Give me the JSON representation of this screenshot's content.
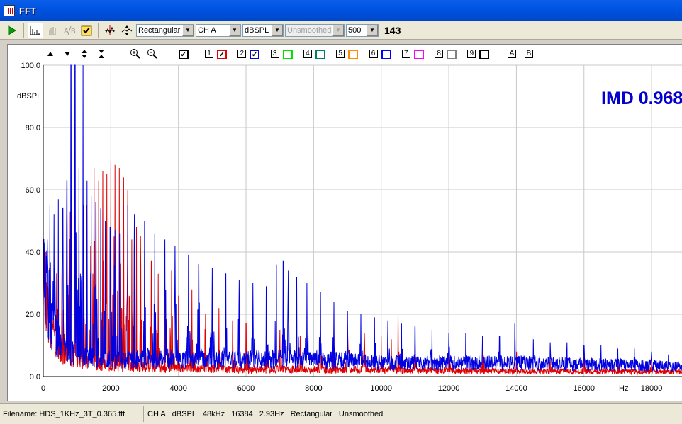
{
  "window": {
    "title": "FFT"
  },
  "toolbar": {
    "window_combo": "Rectangular",
    "channel_combo": "CH A",
    "units_combo": "dBSPL",
    "smoothing_combo": "Unsmoothed",
    "average_combo": "500",
    "count": "143"
  },
  "graph_toolbar": {
    "trace_labels": [
      "1",
      "2",
      "3",
      "4",
      "5",
      "6",
      "7",
      "8",
      "9"
    ],
    "trace_colors": [
      "#e00000",
      "#0000e0",
      "#00e000",
      "#008060",
      "#ff8c00",
      "#0000ff",
      "#ff00ff",
      "#808080",
      "#000000"
    ],
    "trace_checked": [
      true,
      true,
      false,
      false,
      false,
      false,
      false,
      false,
      false
    ],
    "marker_a": "A",
    "marker_b": "B"
  },
  "annotation": {
    "text": "IMD 0.968",
    "color": "#0000d0",
    "marker_color": "#e00000"
  },
  "chart_data": {
    "type": "line",
    "ylabel": "dBSPL",
    "xlabel": "Hz",
    "xlim": [
      0,
      18900
    ],
    "ylim": [
      0,
      100
    ],
    "x_ticks": [
      0,
      2000,
      4000,
      6000,
      8000,
      10000,
      12000,
      14000,
      16000,
      18000
    ],
    "x_tick_labels": [
      "0",
      "2000",
      "4000",
      "6000",
      "8000",
      "10000",
      "12000",
      "14000",
      "16000",
      "18000"
    ],
    "y_ticks": [
      0,
      20,
      40,
      60,
      80,
      100
    ],
    "y_tick_labels": [
      "0.0",
      "20.0",
      "40.0",
      "60.0",
      "80.0",
      "100.0"
    ],
    "grid": true,
    "series": [
      {
        "color": "#e00000",
        "floor": [
          [
            0,
            28
          ],
          [
            250,
            14
          ],
          [
            500,
            8
          ],
          [
            1000,
            5
          ],
          [
            2000,
            3
          ],
          [
            4000,
            2.5
          ],
          [
            6000,
            2
          ],
          [
            10000,
            2
          ],
          [
            14000,
            1.5
          ],
          [
            18900,
            1.5
          ]
        ],
        "peaks": [
          [
            80,
            40
          ],
          [
            180,
            35
          ],
          [
            400,
            33
          ],
          [
            560,
            38
          ],
          [
            700,
            50
          ],
          [
            800,
            53
          ],
          [
            940,
            52
          ],
          [
            1060,
            48
          ],
          [
            1180,
            46
          ],
          [
            1280,
            55
          ],
          [
            1400,
            42
          ],
          [
            1500,
            67
          ],
          [
            1640,
            63
          ],
          [
            1760,
            66
          ],
          [
            1880,
            65
          ],
          [
            2000,
            69
          ],
          [
            2120,
            68
          ],
          [
            2250,
            67
          ],
          [
            2380,
            64
          ],
          [
            2500,
            60
          ],
          [
            2620,
            44
          ],
          [
            2760,
            48
          ],
          [
            2880,
            45
          ],
          [
            3000,
            40
          ],
          [
            3200,
            37
          ],
          [
            3400,
            33
          ],
          [
            3600,
            30
          ],
          [
            3800,
            34
          ],
          [
            4000,
            26
          ],
          [
            4400,
            28
          ],
          [
            4800,
            20
          ],
          [
            5200,
            22
          ],
          [
            5600,
            18
          ],
          [
            6000,
            17
          ],
          [
            6600,
            14
          ],
          [
            7000,
            15
          ],
          [
            7600,
            13
          ],
          [
            8200,
            14
          ],
          [
            8600,
            15
          ],
          [
            9000,
            16
          ],
          [
            9500,
            14
          ],
          [
            10000,
            13
          ],
          [
            10300,
            12
          ],
          [
            10500,
            20
          ],
          [
            11000,
            10
          ],
          [
            12000,
            9
          ],
          [
            13000,
            10
          ],
          [
            14000,
            8
          ],
          [
            15000,
            7
          ],
          [
            16000,
            6
          ],
          [
            17000,
            7
          ],
          [
            18000,
            6
          ]
        ]
      },
      {
        "color": "#0000e0",
        "floor": [
          [
            0,
            30
          ],
          [
            250,
            16
          ],
          [
            500,
            9
          ],
          [
            1000,
            6
          ],
          [
            2000,
            5
          ],
          [
            4000,
            5
          ],
          [
            6000,
            5
          ],
          [
            8000,
            5
          ],
          [
            10000,
            4
          ],
          [
            14000,
            4
          ],
          [
            18900,
            3
          ]
        ],
        "peaks": [
          [
            120,
            44
          ],
          [
            200,
            55
          ],
          [
            320,
            52
          ],
          [
            450,
            57
          ],
          [
            580,
            54
          ],
          [
            700,
            63
          ],
          [
            820,
            100
          ],
          [
            940,
            100
          ],
          [
            1060,
            67
          ],
          [
            1180,
            100
          ],
          [
            1300,
            63
          ],
          [
            1420,
            58
          ],
          [
            1560,
            56
          ],
          [
            1700,
            54
          ],
          [
            1840,
            50
          ],
          [
            1980,
            48
          ],
          [
            2120,
            47
          ],
          [
            2260,
            46
          ],
          [
            2500,
            55
          ],
          [
            2700,
            52
          ],
          [
            3000,
            50
          ],
          [
            3300,
            46
          ],
          [
            3600,
            44
          ],
          [
            3900,
            42
          ],
          [
            4300,
            39
          ],
          [
            4600,
            36
          ],
          [
            5000,
            35
          ],
          [
            5400,
            33
          ],
          [
            5800,
            31
          ],
          [
            6200,
            30
          ],
          [
            6600,
            29
          ],
          [
            6900,
            36
          ],
          [
            7100,
            37
          ],
          [
            7250,
            34
          ],
          [
            7500,
            32
          ],
          [
            7800,
            30
          ],
          [
            8200,
            27
          ],
          [
            8600,
            24
          ],
          [
            9000,
            21
          ],
          [
            9400,
            20
          ],
          [
            9800,
            19
          ],
          [
            10200,
            18
          ],
          [
            10600,
            17
          ],
          [
            11000,
            16
          ],
          [
            11500,
            15
          ],
          [
            12000,
            14
          ],
          [
            12500,
            14
          ],
          [
            13000,
            13
          ],
          [
            13500,
            13
          ],
          [
            13950,
            17
          ],
          [
            14500,
            12
          ],
          [
            15000,
            11
          ],
          [
            15500,
            11
          ],
          [
            16000,
            10
          ],
          [
            16500,
            10
          ],
          [
            17000,
            9
          ],
          [
            17500,
            9
          ],
          [
            18000,
            8
          ],
          [
            18500,
            7
          ]
        ]
      }
    ]
  },
  "status": {
    "filename": "Filename: HDS_1KHz_3T_0.365.fft",
    "channel": "CH A",
    "units": "dBSPL",
    "sample_rate": "48kHz",
    "fft_size": "16384",
    "resolution": "2.93Hz",
    "window": "Rectangular",
    "smoothing": "Unsmoothed"
  }
}
